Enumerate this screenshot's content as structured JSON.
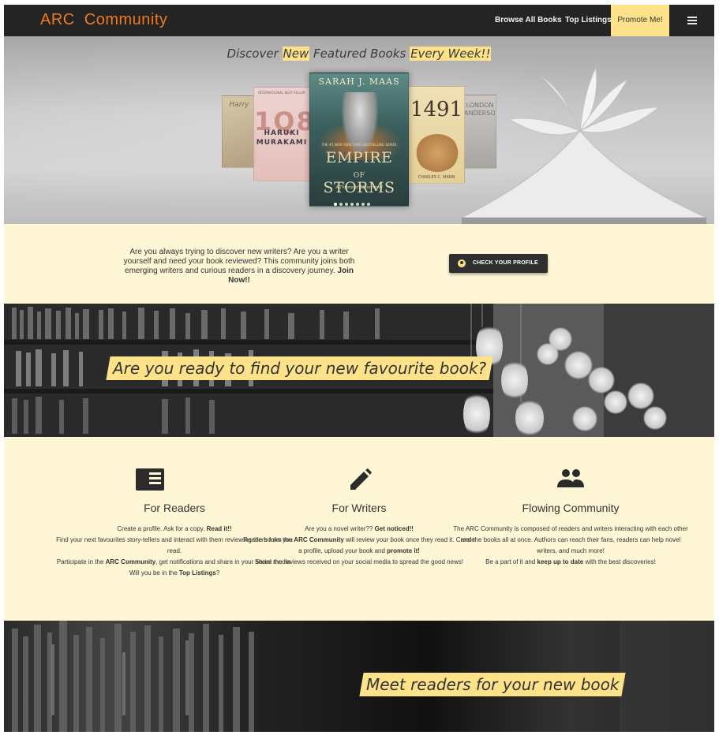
{
  "nav": {
    "brand": "ARC Community",
    "links": {
      "browse": "Browse All Books",
      "top": "Top Listings",
      "promote": "Promote Me!"
    }
  },
  "hero": {
    "title_parts": {
      "a": "Discover ",
      "b": "New",
      "c": " Featured Books ",
      "d": "Every Week!!"
    },
    "books": {
      "empire": {
        "author": "SARAH J. MAAS",
        "tagline": "THE #1 NEW YORK TIMES BESTSELLING SERIES",
        "title_line1": "EMPIRE",
        "title_line2": "OF",
        "title_line3": "STORMS",
        "subtitle": "A Throne of Glass novel"
      },
      "q84": {
        "header": "INTERNATIONAL BEST-SELLER",
        "numbers": "1Q84",
        "author_line1": "HARUKI",
        "author_line2": "MURAKAMI"
      },
      "n1491": {
        "title": "1491",
        "author": "CHARLES C. MANN"
      },
      "london": {
        "line1": "LONDON",
        "line2": "ANDERSON"
      },
      "hp": {
        "title": "Harry"
      }
    },
    "carousel": {
      "count": 7,
      "active": 1
    }
  },
  "intro": {
    "text": "Are you always trying to discover new writers? Are you a writer yourself and need your book reviewed? This community joins both emerging writers and curious readers in a discovery journey. ",
    "bold": "Join Now!!",
    "button": "CHECK YOUR PROFILE"
  },
  "banner1": {
    "title": "Are you ready to find your new favourite book?"
  },
  "features": {
    "readers": {
      "icon": "reader-card-icon",
      "title": "For Readers",
      "l1a": "Create a profile. Ask for a copy. ",
      "l1b": "Read it!!",
      "l2": "Find your next favourites story-tellers and interact with them reviewing the books you read.",
      "l3a": "Participate in the ",
      "l3b": "ARC Community",
      "l3c": ", get notifications and share in your social media.",
      "l4a": "Will you be in the ",
      "l4b": "Top Listings",
      "l4c": "?"
    },
    "writers": {
      "icon": "pencil-icon",
      "title": "For Writers",
      "l1a": "Are you a novel writer?? ",
      "l1b": "Get noticed!!",
      "l2a": "Readers from the ",
      "l2b": "ARC Community",
      "l2c": " will review your book once they read it. Create a profile, upload your book and ",
      "l2d": "promote it!",
      "l3": "Share the reviews received on your social media to spread the good news!"
    },
    "community": {
      "icon": "people-icon",
      "title": "Flowing Community",
      "l1": "The ARC Community is composed of readers and writers interacting with each other and the books all at once. Authors can reach their fans, readers can help novel writers, and much more!",
      "l2a": "Be a part of it and ",
      "l2b": "keep up to date",
      "l2c": " with the best discoveries!"
    }
  },
  "banner2": {
    "title": "Meet readers for your new book"
  },
  "colors": {
    "accent": "#fde28a",
    "brand": "#f07a1e",
    "nav": "#242424",
    "cream": "#fff6d6"
  }
}
